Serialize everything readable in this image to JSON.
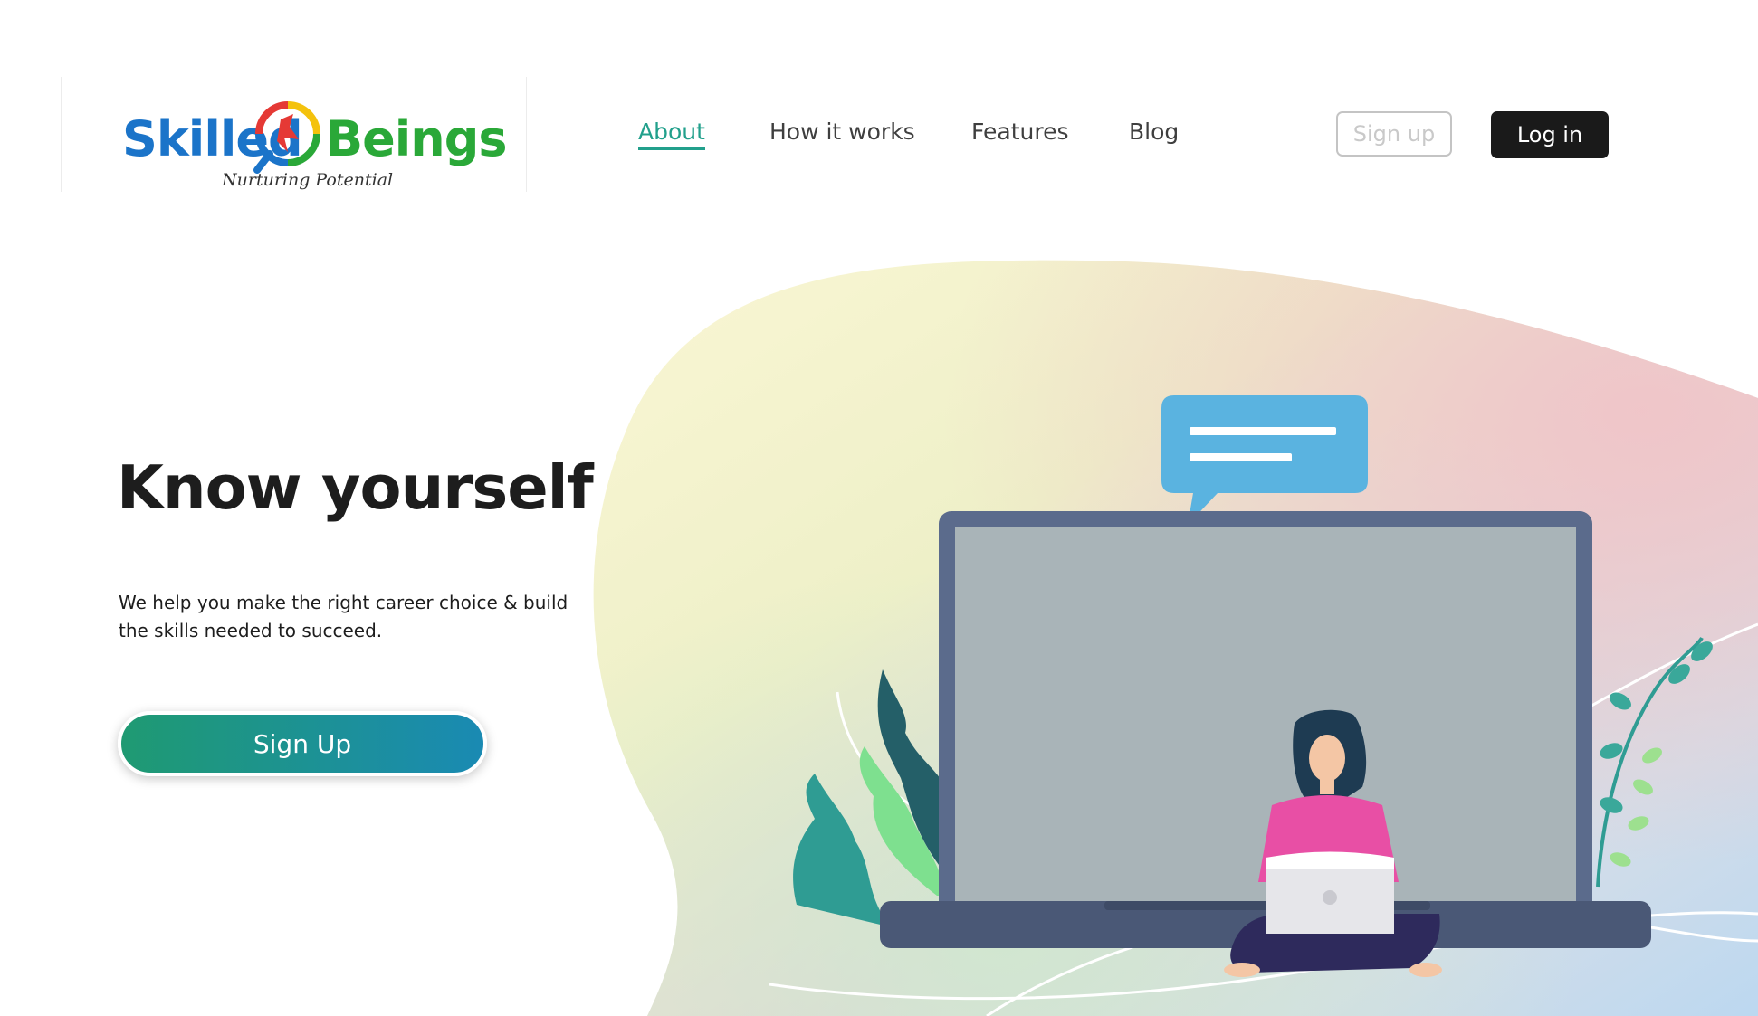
{
  "brand": {
    "name_left": "Skilled",
    "name_right": "Beings",
    "tagline": "Nurturing Potential",
    "colors": {
      "blue": "#1b74c9",
      "green": "#2aa838",
      "red": "#e53935",
      "yellow": "#f4c20d"
    }
  },
  "nav": {
    "items": [
      {
        "label": "About",
        "active": true
      },
      {
        "label": "How it works",
        "active": false
      },
      {
        "label": "Features",
        "active": false
      },
      {
        "label": "Blog",
        "active": false
      }
    ],
    "active_color": "#22a08c"
  },
  "auth": {
    "signup_label": "Sign up",
    "login_label": "Log in"
  },
  "hero": {
    "title": "Know yourself",
    "description": "We help you make the right career choice & build the skills needed to succeed.",
    "cta_label": "Sign Up",
    "cta_gradient": [
      "#1f9a72",
      "#1a8ab3"
    ]
  },
  "illustration": {
    "icons": [
      "chat-bubble-icon",
      "laptop-icon",
      "person-icon",
      "plant-icon",
      "vine-icon"
    ],
    "colors": {
      "chat": "#5ab3e0",
      "laptop_frame": "#5b6b8c",
      "laptop_base": "#4a5876",
      "shirt": "#e84fa5",
      "pants": "#2e2a5c"
    }
  }
}
